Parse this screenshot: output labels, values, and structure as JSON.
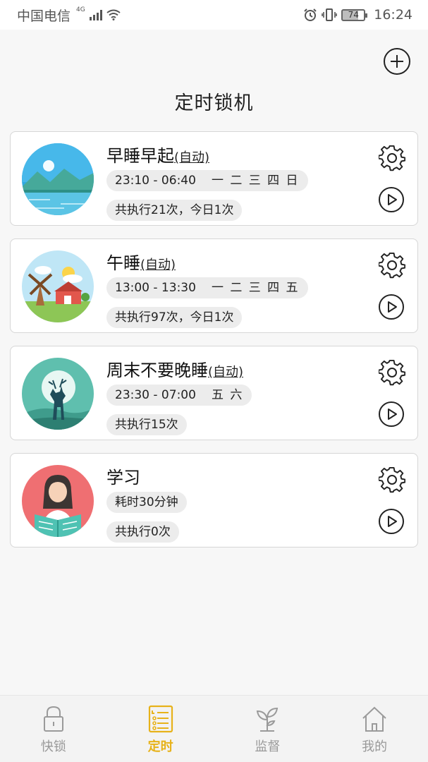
{
  "status_bar": {
    "carrier": "中国电信",
    "network_type": "4G",
    "battery_level": "74",
    "time": "16:24"
  },
  "header": {
    "title": "定时锁机"
  },
  "schedules": [
    {
      "name": "早睡早起",
      "auto_label": "(自动)",
      "time_range": "23:10 - 06:40",
      "days": "一 二 三 四 日",
      "stats": "共执行21次，今日1次",
      "avatar": "lake-mountain-moon"
    },
    {
      "name": "午睡",
      "auto_label": "(自动)",
      "time_range": "13:00 - 13:30",
      "days": "一 二 三 四 五",
      "stats": "共执行97次，今日1次",
      "avatar": "windmill-farm"
    },
    {
      "name": "周末不要晚睡",
      "auto_label": "(自动)",
      "time_range": "23:30 - 07:00",
      "days": "五 六",
      "stats": "共执行15次",
      "avatar": "deer-moon"
    },
    {
      "name": "学习",
      "auto_label": "",
      "duration": "耗时30分钟",
      "stats": "共执行0次",
      "avatar": "girl-reading"
    }
  ],
  "bottom_nav": {
    "items": [
      {
        "label": "快锁",
        "icon": "lock-icon",
        "active": false
      },
      {
        "label": "定时",
        "icon": "schedule-list-icon",
        "active": true
      },
      {
        "label": "监督",
        "icon": "sprout-icon",
        "active": false
      },
      {
        "label": "我的",
        "icon": "home-icon",
        "active": false
      }
    ]
  },
  "colors": {
    "accent": "#e7b21a",
    "inactive": "#999999"
  }
}
